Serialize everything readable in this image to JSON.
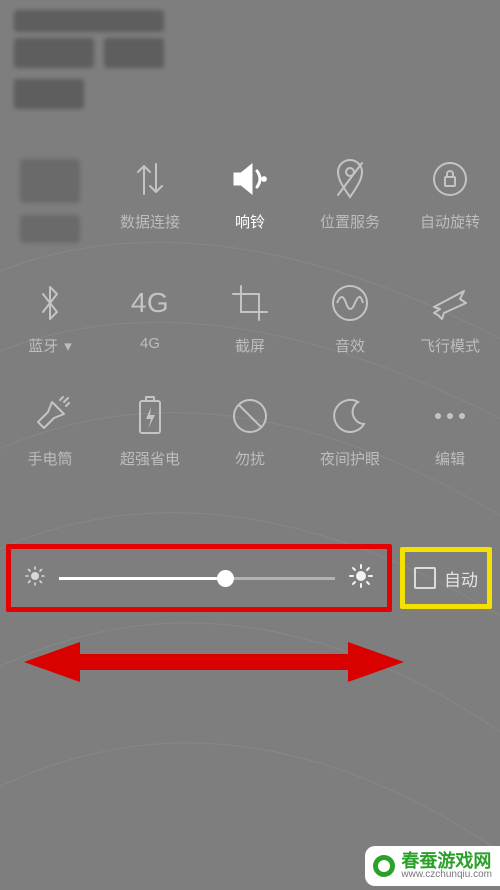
{
  "tiles": {
    "row1": [
      {
        "name": "wifi",
        "label": "",
        "censored_label": true
      },
      {
        "name": "mobile-data",
        "label": "数据连接"
      },
      {
        "name": "ringer",
        "label": "响铃",
        "active": true
      },
      {
        "name": "location",
        "label": "位置服务"
      },
      {
        "name": "auto-rotate",
        "label": "自动旋转"
      }
    ],
    "row2": [
      {
        "name": "bluetooth",
        "label": "蓝牙",
        "has_caret": true
      },
      {
        "name": "4g",
        "label": "4G",
        "big_text": "4G"
      },
      {
        "name": "screenshot",
        "label": "截屏"
      },
      {
        "name": "sound-effect",
        "label": "音效"
      },
      {
        "name": "airplane",
        "label": "飞行模式"
      }
    ],
    "row3": [
      {
        "name": "flashlight",
        "label": "手电筒"
      },
      {
        "name": "power-save",
        "label": "超强省电"
      },
      {
        "name": "dnd",
        "label": "勿扰"
      },
      {
        "name": "night-mode",
        "label": "夜间护眼"
      },
      {
        "name": "edit",
        "label": "编辑"
      }
    ]
  },
  "brightness": {
    "percent": 60,
    "auto_label": "自动",
    "auto_checked": false
  },
  "watermark": {
    "brand": "春蚕游戏网",
    "domain": "www.czchunqiu.com"
  },
  "annotation": {
    "slider_highlight_color": "#e30202",
    "auto_highlight_color": "#f5e100",
    "arrow_color": "#d90000"
  }
}
